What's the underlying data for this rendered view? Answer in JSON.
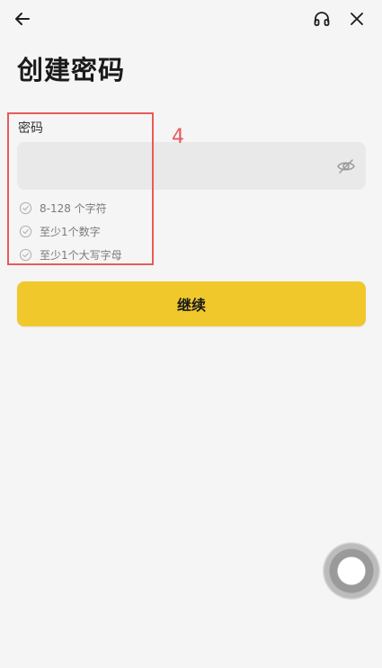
{
  "header": {
    "back_icon": "arrow-left-icon",
    "support_icon": "headset-icon",
    "close_icon": "close-icon"
  },
  "page": {
    "title": "创建密码"
  },
  "password_field": {
    "label": "密码",
    "value": "",
    "placeholder": "",
    "toggle_icon": "eye-off-icon"
  },
  "requirements": [
    {
      "text": "8-128 个字符",
      "icon": "check-circle-icon",
      "met": false
    },
    {
      "text": "至少1个数字",
      "icon": "check-circle-icon",
      "met": false
    },
    {
      "text": "至少1个大写字母",
      "icon": "check-circle-icon",
      "met": false
    }
  ],
  "continue_button": {
    "label": "继续"
  },
  "annotation": {
    "number": "4",
    "color": "#e85a5a"
  },
  "colors": {
    "background": "#f5f5f5",
    "accent": "#f0c82c",
    "input_bg": "#e9e9e9",
    "muted_text": "#7a7a7a"
  },
  "floating_button": {
    "icon": "assistive-touch-icon"
  }
}
